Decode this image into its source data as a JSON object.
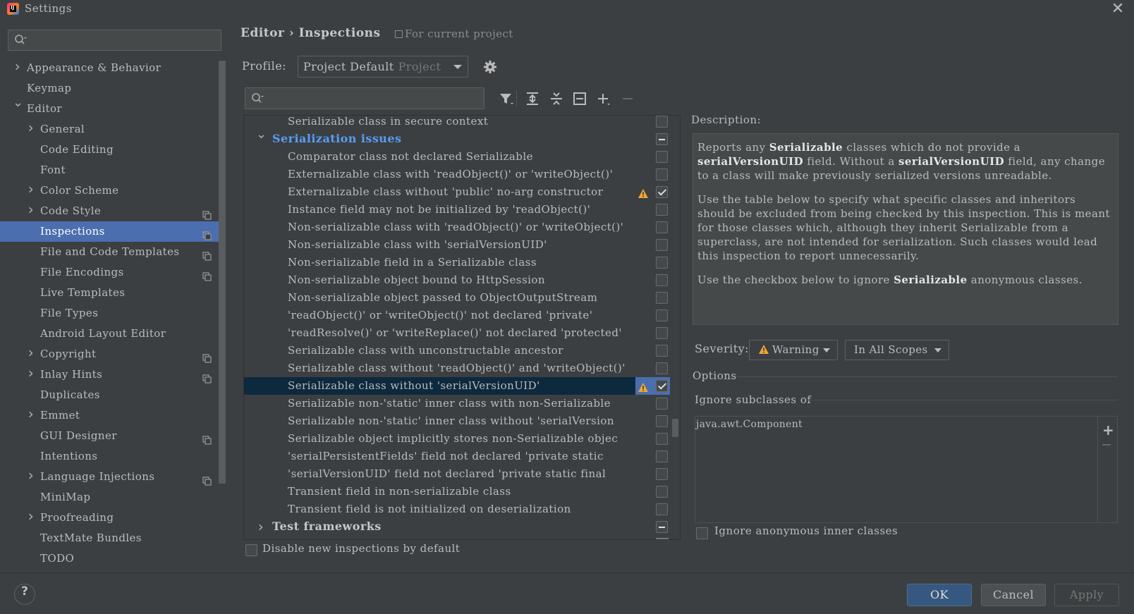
{
  "window": {
    "title": "Settings"
  },
  "sidebar": {
    "search_placeholder": "",
    "items": [
      {
        "label": "Appearance & Behavior",
        "level": 0,
        "expandable": true,
        "expanded": false,
        "copy": false,
        "selected": false
      },
      {
        "label": "Keymap",
        "level": 0,
        "expandable": false,
        "copy": false,
        "selected": false
      },
      {
        "label": "Editor",
        "level": 0,
        "expandable": true,
        "expanded": true,
        "copy": false,
        "selected": false
      },
      {
        "label": "General",
        "level": 1,
        "expandable": true,
        "expanded": false,
        "copy": false,
        "selected": false
      },
      {
        "label": "Code Editing",
        "level": 1,
        "expandable": false,
        "copy": false,
        "selected": false
      },
      {
        "label": "Font",
        "level": 1,
        "expandable": false,
        "copy": false,
        "selected": false
      },
      {
        "label": "Color Scheme",
        "level": 1,
        "expandable": true,
        "expanded": false,
        "copy": false,
        "selected": false
      },
      {
        "label": "Code Style",
        "level": 1,
        "expandable": true,
        "expanded": false,
        "copy": true,
        "selected": false
      },
      {
        "label": "Inspections",
        "level": 1,
        "expandable": false,
        "copy": true,
        "selected": true
      },
      {
        "label": "File and Code Templates",
        "level": 1,
        "expandable": false,
        "copy": true,
        "selected": false
      },
      {
        "label": "File Encodings",
        "level": 1,
        "expandable": false,
        "copy": true,
        "selected": false
      },
      {
        "label": "Live Templates",
        "level": 1,
        "expandable": false,
        "copy": false,
        "selected": false
      },
      {
        "label": "File Types",
        "level": 1,
        "expandable": false,
        "copy": false,
        "selected": false
      },
      {
        "label": "Android Layout Editor",
        "level": 1,
        "expandable": false,
        "copy": false,
        "selected": false
      },
      {
        "label": "Copyright",
        "level": 1,
        "expandable": true,
        "expanded": false,
        "copy": true,
        "selected": false
      },
      {
        "label": "Inlay Hints",
        "level": 1,
        "expandable": true,
        "expanded": false,
        "copy": true,
        "selected": false
      },
      {
        "label": "Duplicates",
        "level": 1,
        "expandable": false,
        "copy": false,
        "selected": false
      },
      {
        "label": "Emmet",
        "level": 1,
        "expandable": true,
        "expanded": false,
        "copy": false,
        "selected": false
      },
      {
        "label": "GUI Designer",
        "level": 1,
        "expandable": false,
        "copy": true,
        "selected": false
      },
      {
        "label": "Intentions",
        "level": 1,
        "expandable": false,
        "copy": false,
        "selected": false
      },
      {
        "label": "Language Injections",
        "level": 1,
        "expandable": true,
        "expanded": false,
        "copy": true,
        "selected": false
      },
      {
        "label": "MiniMap",
        "level": 1,
        "expandable": false,
        "copy": false,
        "selected": false
      },
      {
        "label": "Proofreading",
        "level": 1,
        "expandable": true,
        "expanded": false,
        "copy": false,
        "selected": false
      },
      {
        "label": "TextMate Bundles",
        "level": 1,
        "expandable": false,
        "copy": false,
        "selected": false
      },
      {
        "label": "TODO",
        "level": 1,
        "expandable": false,
        "copy": false,
        "selected": false
      }
    ]
  },
  "header": {
    "breadcrumb": "Editor  ›  Inspections",
    "scope_note": "For current project"
  },
  "profile": {
    "label": "Profile:",
    "value": "Project Default",
    "sub": "Project"
  },
  "toolbar": {
    "icons": [
      "filter-icon",
      "expand-all-icon",
      "collapse-all-icon",
      "reset-icon",
      "add-icon",
      "remove-icon"
    ]
  },
  "inspections": [
    {
      "label": "Serializable class in secure context",
      "type": "item",
      "checked": false
    },
    {
      "label": "Serialization issues",
      "type": "group",
      "expanded": true,
      "checked": "mixed"
    },
    {
      "label": "Comparator class not declared Serializable",
      "type": "item",
      "checked": false
    },
    {
      "label": "Externalizable class with 'readObject()' or 'writeObject()'",
      "type": "item",
      "checked": false
    },
    {
      "label": "Externalizable class without 'public' no-arg constructor",
      "type": "item",
      "checked": true,
      "warning": true
    },
    {
      "label": "Instance field may not be initialized by 'readObject()'",
      "type": "item",
      "checked": false
    },
    {
      "label": "Non-serializable class with 'readObject()' or 'writeObject()'",
      "type": "item",
      "checked": false
    },
    {
      "label": "Non-serializable class with 'serialVersionUID'",
      "type": "item",
      "checked": false
    },
    {
      "label": "Non-serializable field in a Serializable class",
      "type": "item",
      "checked": false
    },
    {
      "label": "Non-serializable object bound to HttpSession",
      "type": "item",
      "checked": false
    },
    {
      "label": "Non-serializable object passed to ObjectOutputStream",
      "type": "item",
      "checked": false
    },
    {
      "label": "'readObject()' or 'writeObject()' not declared 'private'",
      "type": "item",
      "checked": false
    },
    {
      "label": "'readResolve()' or 'writeReplace()' not declared 'protected'",
      "type": "item",
      "checked": false
    },
    {
      "label": "Serializable class with unconstructable ancestor",
      "type": "item",
      "checked": false
    },
    {
      "label": "Serializable class without 'readObject()' and 'writeObject()'",
      "type": "item",
      "checked": false
    },
    {
      "label": "Serializable class without 'serialVersionUID'",
      "type": "item",
      "checked": true,
      "warning": true,
      "selected": true
    },
    {
      "label": "Serializable non-'static' inner class with non-Serializable",
      "type": "item",
      "checked": false
    },
    {
      "label": "Serializable non-'static' inner class without 'serialVersion",
      "type": "item",
      "checked": false
    },
    {
      "label": "Serializable object implicitly stores non-Serializable objec",
      "type": "item",
      "checked": false
    },
    {
      "label": "'serialPersistentFields' field not declared 'private static",
      "type": "item",
      "checked": false
    },
    {
      "label": "'serialVersionUID' field not declared 'private static final",
      "type": "item",
      "checked": false
    },
    {
      "label": "Transient field in non-serializable class",
      "type": "item",
      "checked": false
    },
    {
      "label": "Transient field is not initialized on deserialization",
      "type": "item",
      "checked": false
    },
    {
      "label": "Test frameworks",
      "type": "group",
      "expanded": false,
      "checked": "mixed",
      "plain": true
    }
  ],
  "disable_new": {
    "label": "Disable new inspections by default",
    "checked": false
  },
  "description": {
    "label": "Description:",
    "p1": [
      {
        "t": "Reports any ",
        "b": false
      },
      {
        "t": "Serializable",
        "b": true
      },
      {
        "t": " classes which do not provide a ",
        "b": false
      },
      {
        "t": "serialVersionUID",
        "b": true
      },
      {
        "t": " field. Without a ",
        "b": false
      },
      {
        "t": "serialVersionUID",
        "b": true
      },
      {
        "t": " field, any change to a class will make previously serialized versions unreadable.",
        "b": false
      }
    ],
    "p2": "Use the table below to specify what specific classes and inheritors should be excluded from being checked by this inspection. This is meant for those classes which, although they inherit Serializable from a superclass, are not intended for serialization. Such classes would lead this inspection to report unnecessarily.",
    "p3": [
      {
        "t": "Use the checkbox below to ignore ",
        "b": false
      },
      {
        "t": "Serializable",
        "b": true
      },
      {
        "t": " anonymous classes.",
        "b": false
      }
    ]
  },
  "severity": {
    "label": "Severity:",
    "value": "Warning",
    "scope": "In All Scopes"
  },
  "options": {
    "label": "Options",
    "ignore_label": "Ignore subclasses of",
    "ignore_items": [
      "java.awt.Component"
    ],
    "anon_label": "Ignore anonymous inner classes",
    "anon_checked": false
  },
  "footer": {
    "ok": "OK",
    "cancel": "Cancel",
    "apply": "Apply",
    "help": "?"
  },
  "colors": {
    "background": "#3c3f41",
    "selection": "#4b6eaf",
    "group_text": "#589df6",
    "warning": "#f0a732"
  }
}
